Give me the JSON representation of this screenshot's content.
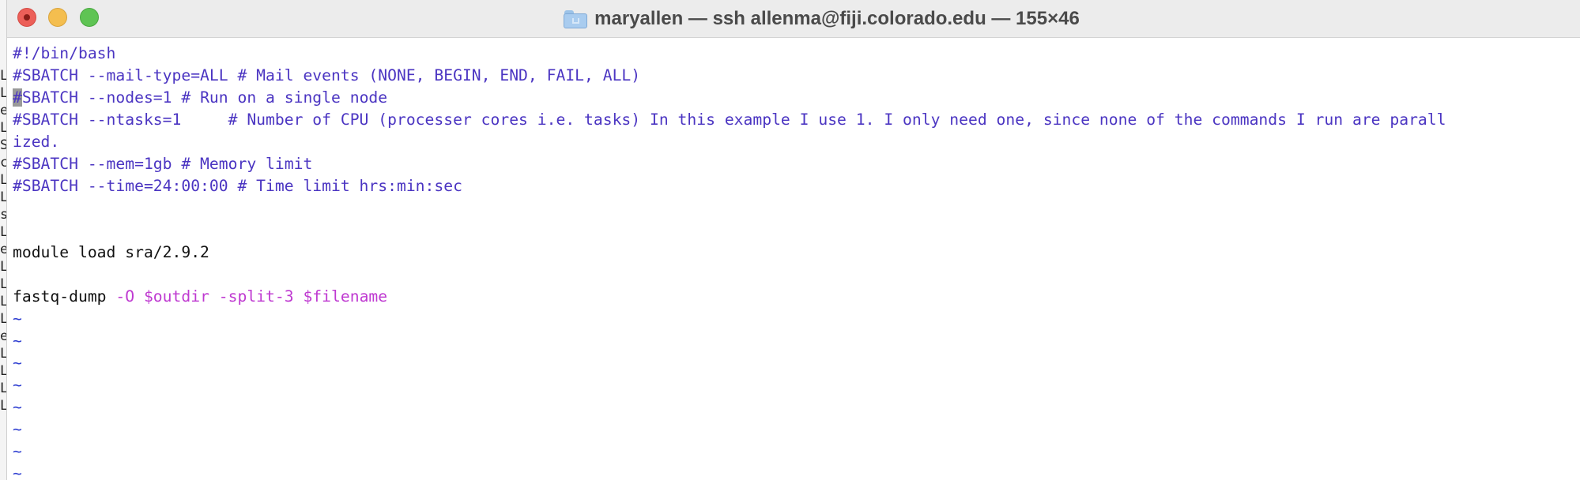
{
  "window": {
    "title": "maryallen — ssh allenma@fiji.colorado.edu — 155×46",
    "controls": [
      "close",
      "minimize",
      "zoom"
    ]
  },
  "background_window_chars": [
    "L",
    "L",
    "e",
    "L",
    "S",
    "c",
    "L",
    "L",
    "s",
    "L",
    "e",
    "L",
    "L",
    "L",
    "L",
    "e",
    "L",
    "L",
    "L",
    "L"
  ],
  "editor": {
    "lines": [
      {
        "segments": [
          {
            "text": "#!/bin/bash",
            "style": "comment"
          }
        ]
      },
      {
        "segments": [
          {
            "text": "#SBATCH --mail-type=ALL # Mail events (NONE, BEGIN, END, FAIL, ALL)",
            "style": "comment"
          }
        ]
      },
      {
        "segments": [
          {
            "text": "#",
            "style": "cursor"
          },
          {
            "text": "SBATCH --nodes=1 # Run on a single node",
            "style": "comment"
          }
        ]
      },
      {
        "segments": [
          {
            "text": "#SBATCH --ntasks=1     # Number of CPU (processer cores i.e. tasks) In this example I use 1. I only need one, since none of the commands I run are parall",
            "style": "comment"
          }
        ]
      },
      {
        "segments": [
          {
            "text": "ized.",
            "style": "comment"
          }
        ]
      },
      {
        "segments": [
          {
            "text": "#SBATCH --mem=1gb # Memory limit",
            "style": "comment"
          }
        ]
      },
      {
        "segments": [
          {
            "text": "#SBATCH --time=24:00:00 # Time limit hrs:min:sec",
            "style": "comment"
          }
        ]
      },
      {
        "segments": [
          {
            "text": "",
            "style": "normal"
          }
        ]
      },
      {
        "segments": [
          {
            "text": "",
            "style": "normal"
          }
        ]
      },
      {
        "segments": [
          {
            "text": "module load sra/2.9.2",
            "style": "normal"
          }
        ]
      },
      {
        "segments": [
          {
            "text": "",
            "style": "normal"
          }
        ]
      },
      {
        "segments": [
          {
            "text": "fastq-dump ",
            "style": "normal"
          },
          {
            "text": "-O $outdir -split-3 $filename",
            "style": "flag"
          }
        ]
      },
      {
        "segments": [
          {
            "text": "~",
            "style": "tilde"
          }
        ]
      },
      {
        "segments": [
          {
            "text": "~",
            "style": "tilde"
          }
        ]
      },
      {
        "segments": [
          {
            "text": "~",
            "style": "tilde"
          }
        ]
      },
      {
        "segments": [
          {
            "text": "~",
            "style": "tilde"
          }
        ]
      },
      {
        "segments": [
          {
            "text": "~",
            "style": "tilde"
          }
        ]
      },
      {
        "segments": [
          {
            "text": "~",
            "style": "tilde"
          }
        ]
      },
      {
        "segments": [
          {
            "text": "~",
            "style": "tilde"
          }
        ]
      },
      {
        "segments": [
          {
            "text": "~",
            "style": "tilde"
          }
        ]
      }
    ]
  },
  "colors": {
    "comment": "#4b35c2",
    "normal": "#111111",
    "flag": "#bf3ad1",
    "tilde": "#2f3fd1",
    "titlebar": "#ececec"
  }
}
